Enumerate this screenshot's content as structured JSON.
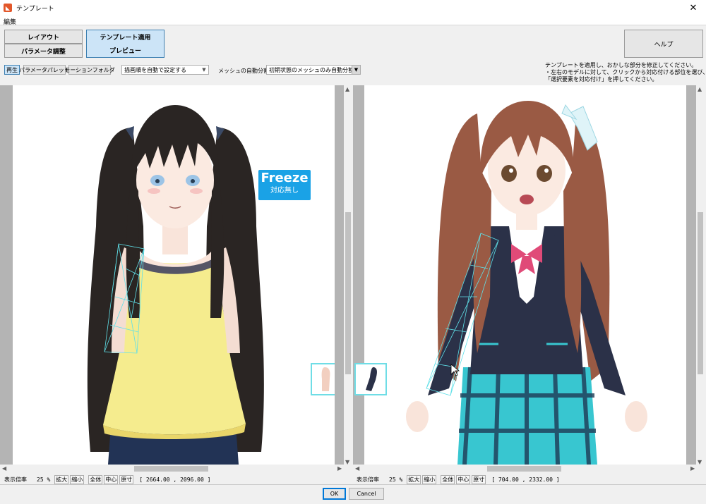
{
  "window": {
    "title": "テンプレート",
    "close_glyph": "✕"
  },
  "menu": {
    "edit": "編集"
  },
  "modes": {
    "layout": "レイアウト",
    "param_adjust": "パラメータ調整",
    "apply_template": "テンプレート適用",
    "preview": "プレビュー"
  },
  "help_button": "ヘルプ",
  "toolbar": {
    "play": "再生",
    "param_palette": "パラメータパレット",
    "motion_folder": "モーションフォルダ",
    "draw_order_select": "描画順を自動で設定する",
    "mesh_split_label": "メッシュの自動分割",
    "mesh_split_select": "初期状態のメッシュのみ自動分割"
  },
  "help_text": [
    "テンプレートを適用し、おかしな部分を修正してください。",
    "・左右のモデルに対して、クリックから対応付ける部位を選び、",
    "「選択要素を対応付け」を押してください。"
  ],
  "freeze": {
    "title": "Freeze",
    "subtitle": "対応無し"
  },
  "left_status": {
    "label": "表示倍率",
    "zoom": "25 %",
    "zoom_in": "拡大",
    "zoom_out": "縮小",
    "fit": "全体",
    "center": "中心",
    "original": "原寸",
    "coords": "[ 2664.00 , 2096.00 ]"
  },
  "right_status": {
    "label": "表示倍率",
    "zoom": "25 %",
    "zoom_in": "拡大",
    "zoom_out": "縮小",
    "fit": "全体",
    "center": "中心",
    "original": "原寸",
    "coords": "[ 704.00 , 2332.00 ]"
  },
  "dialog": {
    "ok": "OK",
    "cancel": "Cancel"
  },
  "colors": {
    "accent": "#1aa2e6",
    "mesh": "#5fe0e8",
    "active_button": "#cce4f7",
    "jacket": "#2b3148",
    "skirt": "#38c6d0",
    "dress": "#f5ec8e",
    "dark_hair": "#2a2523",
    "brown_hair": "#9a5a44"
  }
}
